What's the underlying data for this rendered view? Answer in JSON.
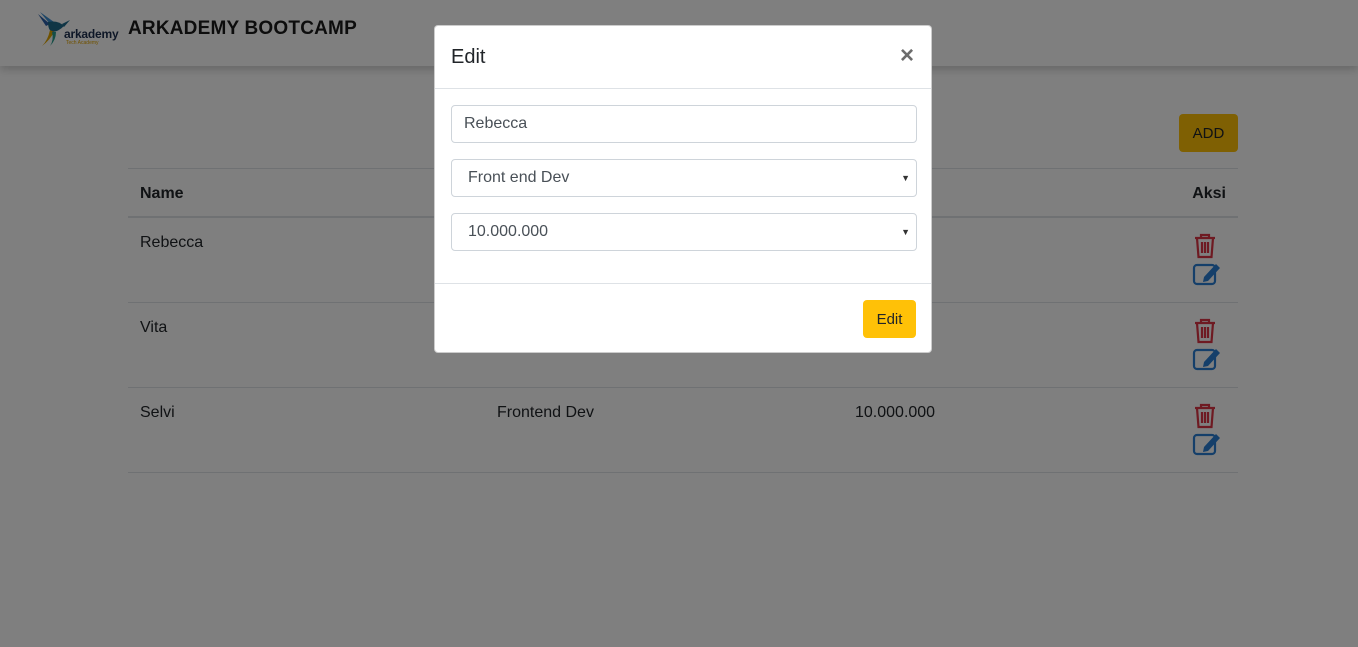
{
  "header": {
    "logo_text": "arkademy",
    "logo_sub": "Tech Academy",
    "brand": "ARKADEMY BOOTCAMP"
  },
  "toolbar": {
    "add_label": "ADD"
  },
  "table": {
    "headers": {
      "name": "Name",
      "aksi": "Aksi"
    },
    "rows": [
      {
        "name": "Rebecca",
        "role": "",
        "salary": ""
      },
      {
        "name": "Vita",
        "role": "",
        "salary": ""
      },
      {
        "name": "Selvi",
        "role": "Frontend Dev",
        "salary": "10.000.000"
      }
    ]
  },
  "modal": {
    "title": "Edit",
    "close_label": "×",
    "name_value": "Rebecca",
    "role_value": "Front end Dev",
    "salary_value": "10.000.000",
    "submit_label": "Edit"
  },
  "colors": {
    "accent": "#ffc107",
    "delete_icon": "#dc3545",
    "edit_icon": "#2a7fd4"
  },
  "icons": [
    "trash-icon",
    "edit-icon",
    "close-icon",
    "caret-down-icon",
    "hummingbird-logo"
  ]
}
